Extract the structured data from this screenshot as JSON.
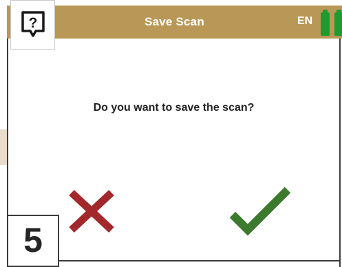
{
  "header": {
    "title": "Save Scan",
    "language": "EN",
    "battery_icon": "battery-full-icon",
    "battery_color": "#1e9b2f",
    "background_color": "#b99857"
  },
  "help": {
    "icon": "help-question-icon"
  },
  "dialog": {
    "question": "Do you want to save the scan?",
    "cancel_icon": "cross-icon",
    "cancel_color": "#a3282b",
    "confirm_icon": "checkmark-icon",
    "confirm_color": "#3c7a2d"
  },
  "step_label": "5"
}
